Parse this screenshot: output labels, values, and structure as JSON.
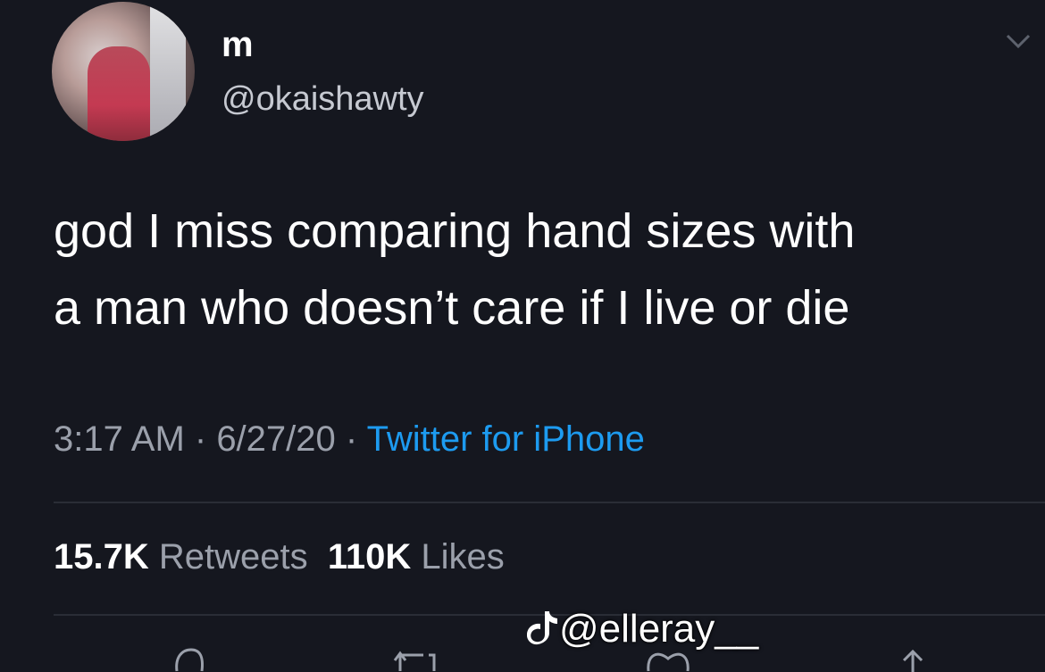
{
  "tweet": {
    "display_name": "m",
    "handle": "@okaishawty",
    "text_line1": "god I miss comparing hand sizes with",
    "text_line2": "a man who doesn’t care if I live or die",
    "time": "3:17 AM",
    "date": "6/27/20",
    "separator": " · ",
    "source": "Twitter for iPhone",
    "retweets_count": "15.7K",
    "retweets_label": "Retweets",
    "likes_count": "110K",
    "likes_label": "Likes"
  },
  "watermark": {
    "text": "@elleray__",
    "icon": "tiktok-icon"
  },
  "icons": [
    "chevron-down-icon",
    "reply-icon",
    "retweet-icon",
    "like-icon",
    "share-icon"
  ],
  "colors": {
    "background": "#15171f",
    "text": "#ffffff",
    "muted": "#9ba0ab",
    "accent": "#1d9bf0"
  }
}
